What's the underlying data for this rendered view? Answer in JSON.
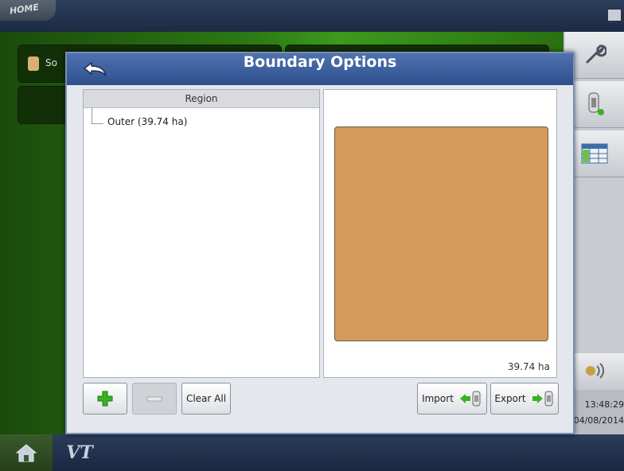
{
  "topbar": {
    "logo_text": "HOME"
  },
  "dialog": {
    "title": "Boundary Options",
    "region_header": "Region",
    "regions": [
      {
        "label": "Outer (39.74 ha)"
      }
    ],
    "area_label": "39.74 ha",
    "buttons": {
      "add": "+",
      "remove": "−",
      "clear_all": "Clear All",
      "import": "Import",
      "export": "Export"
    }
  },
  "background": {
    "card_label": "So"
  },
  "sidebar": {
    "time": "13:48:29",
    "date": "04/08/2014"
  },
  "bottombar": {
    "vt_label": "VT"
  },
  "colors": {
    "title_bar": "#3d5f9e",
    "field_fill": "#d49a5c",
    "add_green": "#37b321"
  },
  "icons": [
    "back-arrow-icon",
    "wrench-icon",
    "implement-icon",
    "table-icon",
    "home-icon",
    "import-icon",
    "export-icon",
    "gps-icon"
  ]
}
